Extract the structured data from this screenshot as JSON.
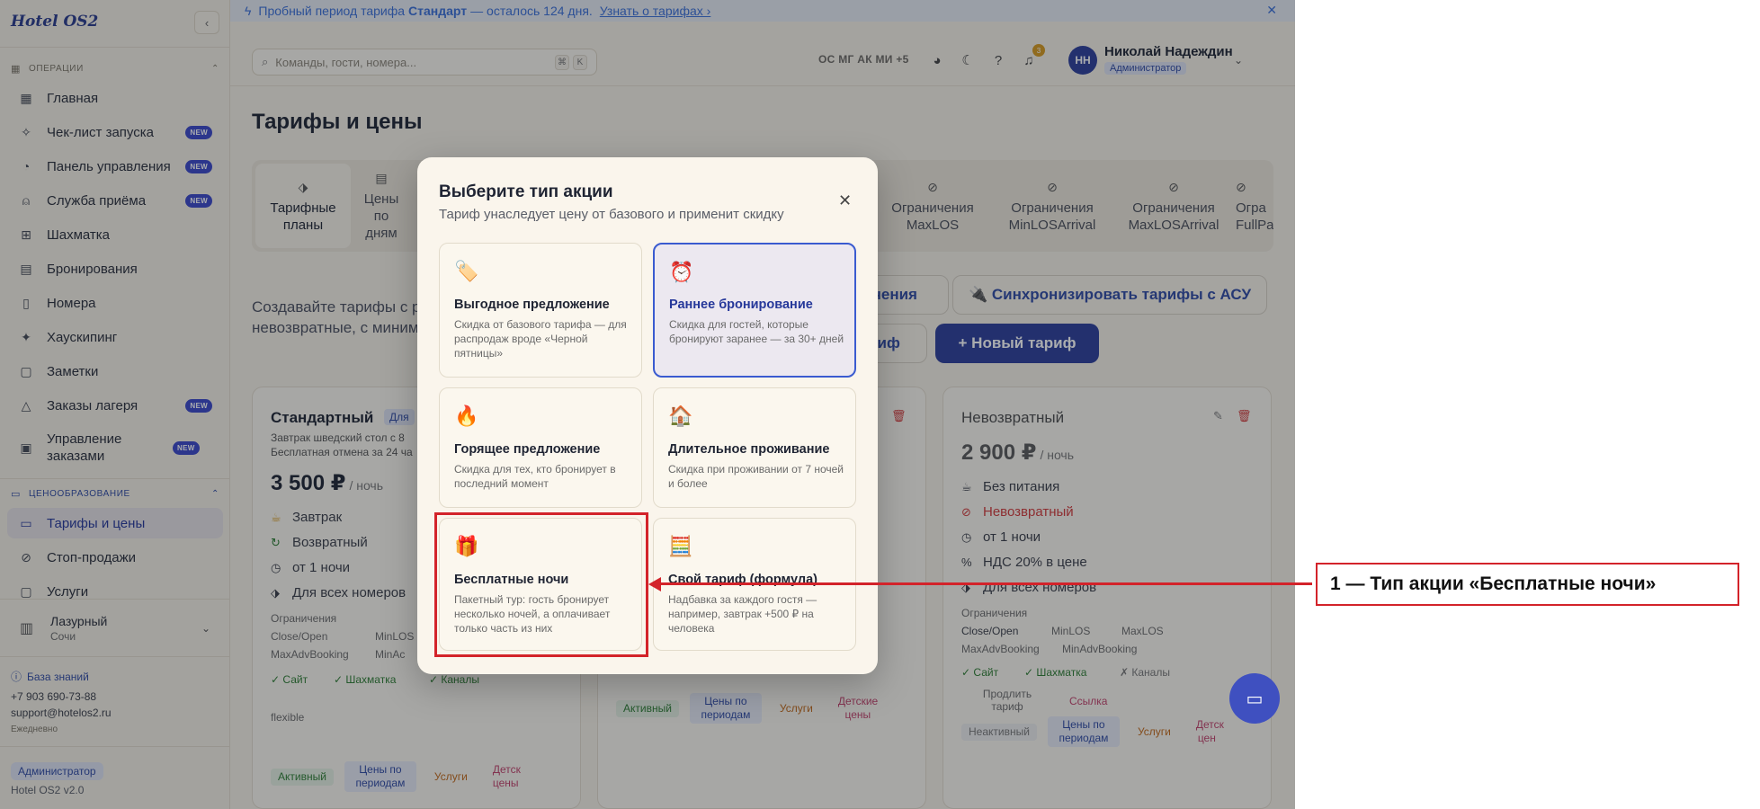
{
  "sidebar": {
    "logo": "Hotel OS2",
    "section_ops": "ОПЕРАЦИИ",
    "items": [
      {
        "label": "Главная",
        "badge": ""
      },
      {
        "label": "Чек-лист запуска",
        "badge": "NEW"
      },
      {
        "label": "Панель управления",
        "badge": "NEW"
      },
      {
        "label": "Служба приёма",
        "badge": "NEW"
      },
      {
        "label": "Шахматка",
        "badge": ""
      },
      {
        "label": "Бронирования",
        "badge": ""
      },
      {
        "label": "Номера",
        "badge": ""
      },
      {
        "label": "Хаускипинг",
        "badge": ""
      },
      {
        "label": "Заметки",
        "badge": ""
      },
      {
        "label": "Заказы лагеря",
        "badge": "NEW"
      },
      {
        "label": "Управление заказами",
        "badge": "NEW"
      }
    ],
    "section_pricing": "ЦЕНООБРАЗОВАНИЕ",
    "pricing_items": [
      {
        "label": "Тарифы и цены"
      },
      {
        "label": "Стоп-продажи"
      },
      {
        "label": "Услуги"
      }
    ],
    "property": {
      "name": "Лазурный",
      "city": "Сочи"
    },
    "knowledge_base": "База знаний",
    "phone": "+7 903 690-73-88",
    "email": "support@hotelos2.ru",
    "hours": "Ежедневно",
    "role": "Администратор",
    "version": "Hotel OS2 v2.0"
  },
  "banner": {
    "prefix": "Пробный период тарифа",
    "plan": "Стандарт",
    "suffix": "— осталось 124 дня.",
    "link": "Узнать о тарифах ›"
  },
  "topbar": {
    "search_placeholder": "Команды, гости, номера...",
    "kbd1": "⌘",
    "kbd2": "K",
    "presence": "ОС МГ АК МИ +5",
    "notif_count": "3",
    "avatar_initials": "НН",
    "user_name": "Николай Надеждин",
    "user_role": "Администратор"
  },
  "page": {
    "title": "Тарифы и цены",
    "tabs": [
      {
        "label": "Тарифные планы"
      },
      {
        "label": "Цены по дням"
      },
      {
        "label": "Ограничения MaxLOS"
      },
      {
        "label": "Ограничения MinLOSArrival"
      },
      {
        "label": "Ограничения MaxLOSArrival"
      },
      {
        "label": "Огра FullPa"
      }
    ],
    "lead_line1": "Создавайте тарифы с р",
    "lead_line2": "невозвратные, с миним",
    "btn_restrictions": "чения",
    "btn_sync": "🔌 Синхронизировать тарифы с АСУ",
    "btn_tariff": "риф",
    "btn_new": "+  Новый тариф"
  },
  "cards": {
    "standard": {
      "title": "Стандартный",
      "chip": "Для",
      "desc1": "Завтрак шведский стол с 8",
      "desc2": "Бесплатная отмена за 24 ча",
      "price": "3 500 ₽",
      "per": "/ ночь",
      "f1": "Завтрак",
      "f2": "Возвратный",
      "f3": "от 1 ночи",
      "f4": "Для всех номеров",
      "restr_label": "Ограничения",
      "restr1": "Close/Open",
      "restr2": "MinLOS",
      "restr3": "MaxAdvBooking",
      "restr4": "MinAc",
      "ch1": "✓ Сайт",
      "ch2": "✓ Шахматка",
      "ch3": "✓ Каналы",
      "code": "flexible",
      "s1": "Активный",
      "s2": "Цены по периодам",
      "s3": "Услуги",
      "s4": "Детск цены"
    },
    "middle": {
      "s1": "Активный",
      "s2": "Цены по периодам",
      "s3": "Услуги",
      "s4": "Детские цены"
    },
    "nonref": {
      "title": "Невозвратный",
      "price": "2 900 ₽",
      "per": "/ ночь",
      "f1": "Без питания",
      "f2": "Невозвратный",
      "f3": "от 1 ночи",
      "f4": "НДС 20% в цене",
      "f5": "Для всех номеров",
      "restr_label": "Ограничения",
      "restr1": "Close/Open",
      "restr2": "MinLOS",
      "restr3": "MaxLOS",
      "restr4": "MaxAdvBooking",
      "restr5": "MinAdvBooking",
      "ch1": "✓ Сайт",
      "ch2": "✓ Шахматка",
      "ch3": "✗ Каналы",
      "extend": "Продлить тариф",
      "link": "Ссылка",
      "s1": "Неактивный",
      "s2": "Цены по периодам",
      "s3": "Услуги",
      "s4": "Детск цен"
    }
  },
  "modal": {
    "title": "Выберите тип акции",
    "subtitle": "Тариф унаследует цену от базового и применит скидку",
    "options": [
      {
        "emoji": "🏷️",
        "title": "Выгодное предложение",
        "desc": "Скидка от базового тарифа — для распродаж вроде «Черной пятницы»"
      },
      {
        "emoji": "⏰",
        "title": "Раннее бронирование",
        "desc": "Скидка для гостей, которые бронируют заранее — за 30+ дней"
      },
      {
        "emoji": "🔥",
        "title": "Горящее предложение",
        "desc": "Скидка для тех, кто бронирует в последний момент"
      },
      {
        "emoji": "🏠",
        "title": "Длительное проживание",
        "desc": "Скидка при проживании от 7 ночей и более"
      },
      {
        "emoji": "🎁",
        "title": "Бесплатные ночи",
        "desc": "Пакетный тур: гость бронирует несколько ночей, а оплачивает только часть из них"
      },
      {
        "emoji": "🧮",
        "title": "Свой тариф (формула)",
        "desc": "Надбавка за каждого гостя — например, завтрак +500 ₽ на человека"
      }
    ]
  },
  "annotation": {
    "label": "1 — Тип акции «Бесплатные ночи»"
  },
  "colors": {
    "accent": "#2c3e9a",
    "annotation": "#d3232a",
    "selected_border": "#3a5bd0"
  }
}
